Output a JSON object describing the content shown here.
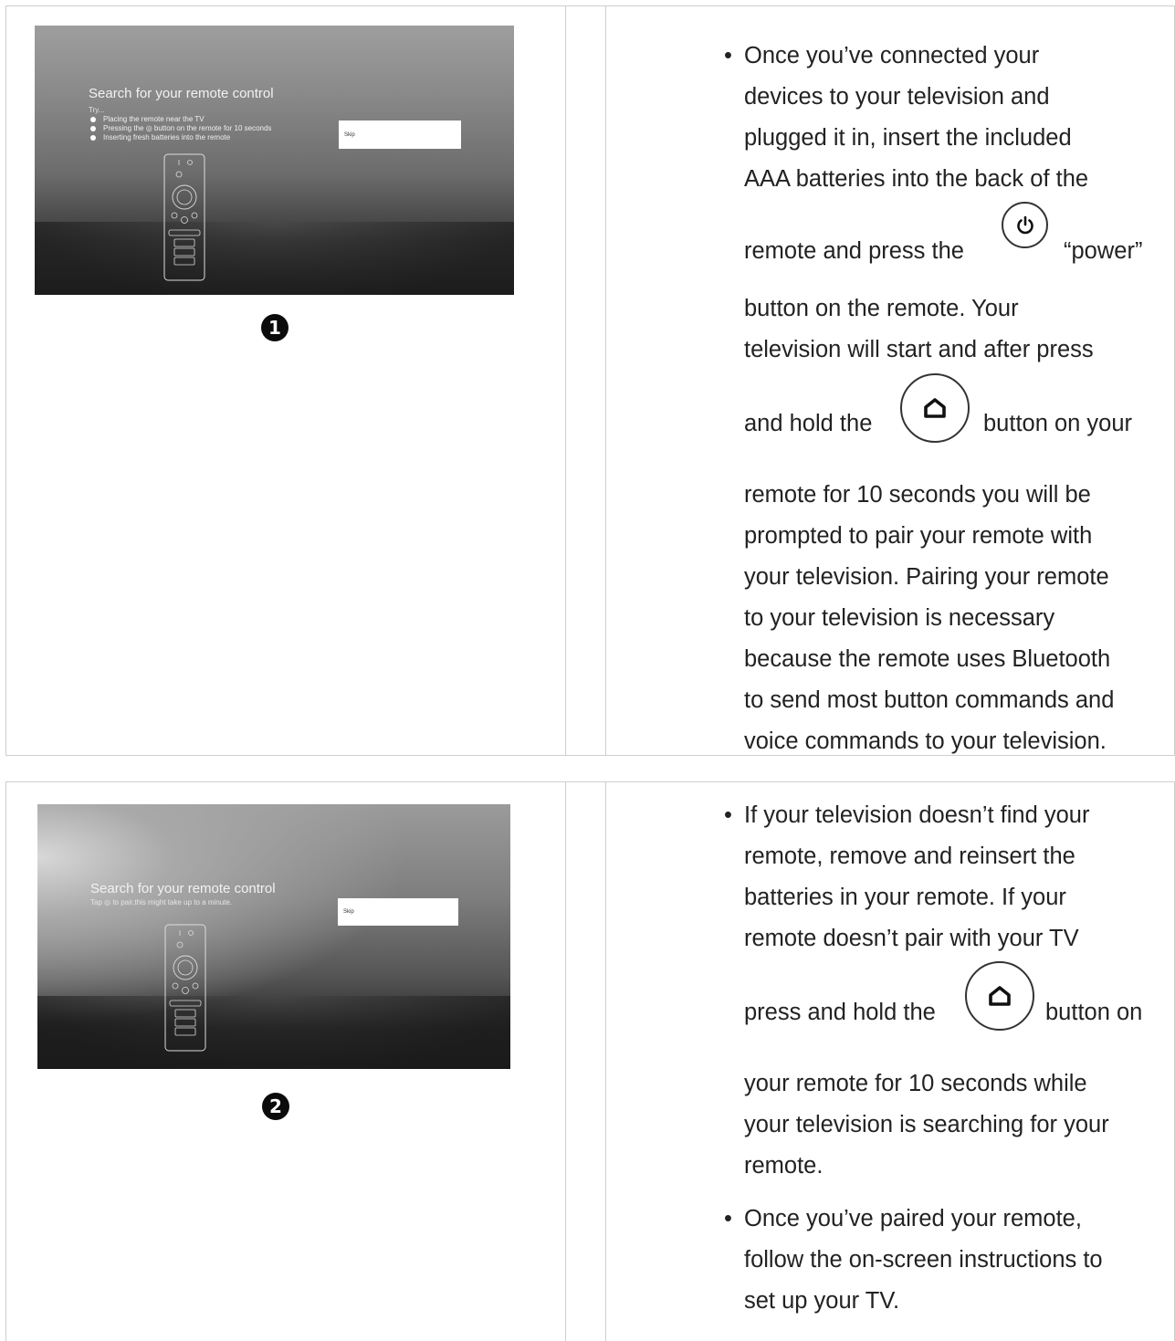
{
  "step1": {
    "badge": "1",
    "tv": {
      "title": "Search for your remote control",
      "try_label": "Try...",
      "tips": [
        "Placing the remote near the TV",
        "Pressing the ◎ button on the remote for 10 seconds",
        "Inserting fresh batteries into the remote"
      ],
      "skip_label": "Skip"
    },
    "text_lines": [
      "Once you’ve connected your",
      "devices to your television and",
      "plugged it in, insert the included",
      "AAA batteries into the back of the"
    ],
    "power_before": "remote and press the",
    "power_after": "“power”",
    "text_lines_2": [
      "button on the remote. Your",
      "television will start and after press"
    ],
    "home_before": "and hold the",
    "home_after": "button on your",
    "text_lines_3": [
      "remote for 10 seconds you will be",
      "prompted to pair your remote with",
      "your television. Pairing your remote",
      "to your television is necessary",
      "because the remote uses Bluetooth",
      "to send most button commands and",
      "voice commands to your television."
    ]
  },
  "step2": {
    "badge": "2",
    "tv": {
      "title": "Search for your remote control",
      "subtitle": "Tap ◎ to pair,this might take up to a minute.",
      "skip_label": "Skip"
    },
    "para1_lines": [
      "If your television doesn’t find your",
      "remote, remove and reinsert the",
      "batteries in your remote. If your",
      "remote doesn’t pair with your TV"
    ],
    "home_before": "press and hold the",
    "home_after": "button on",
    "para1_lines_2": [
      "your remote for 10 seconds while",
      "your television is searching for your",
      "remote."
    ],
    "para2_lines": [
      "Once you’ve paired your remote,",
      "follow the on-screen instructions to",
      "set up your TV."
    ],
    "bullet": "•"
  },
  "icons": {
    "power": "power-icon",
    "home": "home-icon"
  }
}
